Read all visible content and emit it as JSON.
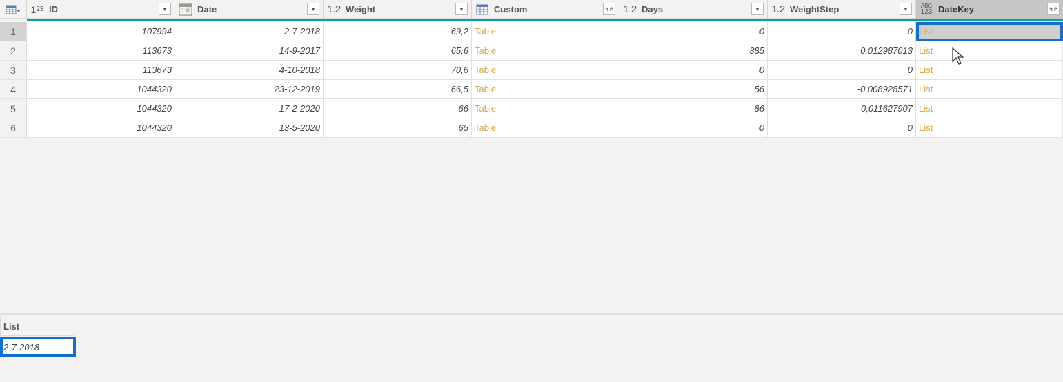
{
  "table_menu_icon": "table-menu-icon",
  "columns": [
    {
      "name": "ID",
      "type_icon": "1²₃",
      "type": "whole-number",
      "button": "filter-dropdown"
    },
    {
      "name": "Date",
      "type_icon": "calendar",
      "type": "date",
      "button": "filter-dropdown"
    },
    {
      "name": "Weight",
      "type_icon": "1.2",
      "type": "decimal",
      "button": "filter-dropdown"
    },
    {
      "name": "Custom",
      "type_icon": "table",
      "type": "table",
      "button": "expand"
    },
    {
      "name": "Days",
      "type_icon": "1.2",
      "type": "decimal",
      "button": "filter-dropdown"
    },
    {
      "name": "WeightStep",
      "type_icon": "1.2",
      "type": "decimal",
      "button": "filter-dropdown"
    },
    {
      "name": "DateKey",
      "type_icon": "ABC 123",
      "type": "any",
      "button": "expand"
    }
  ],
  "rows": [
    {
      "n": "1",
      "id": "107994",
      "date": "2-7-2018",
      "weight": "69,2",
      "custom": "Table",
      "days": "0",
      "weightstep": "0",
      "datekey": "List"
    },
    {
      "n": "2",
      "id": "113673",
      "date": "14-9-2017",
      "weight": "65,6",
      "custom": "Table",
      "days": "385",
      "weightstep": "0,012987013",
      "datekey": "List"
    },
    {
      "n": "3",
      "id": "113673",
      "date": "4-10-2018",
      "weight": "70,6",
      "custom": "Table",
      "days": "0",
      "weightstep": "0",
      "datekey": "List"
    },
    {
      "n": "4",
      "id": "1044320",
      "date": "23-12-2019",
      "weight": "66,5",
      "custom": "Table",
      "days": "56",
      "weightstep": "-0,008928571",
      "datekey": "List"
    },
    {
      "n": "5",
      "id": "1044320",
      "date": "17-2-2020",
      "weight": "66",
      "custom": "Table",
      "days": "86",
      "weightstep": "-0,011627907",
      "datekey": "List"
    },
    {
      "n": "6",
      "id": "1044320",
      "date": "13-5-2020",
      "weight": "65",
      "custom": "Table",
      "days": "0",
      "weightstep": "0",
      "datekey": "List"
    }
  ],
  "preview": {
    "header": "List",
    "value": "2-7-2018"
  },
  "colors": {
    "accent_teal": "#0aa1a4",
    "selection_blue": "#1170cf",
    "link_gold": "#d9a745"
  }
}
